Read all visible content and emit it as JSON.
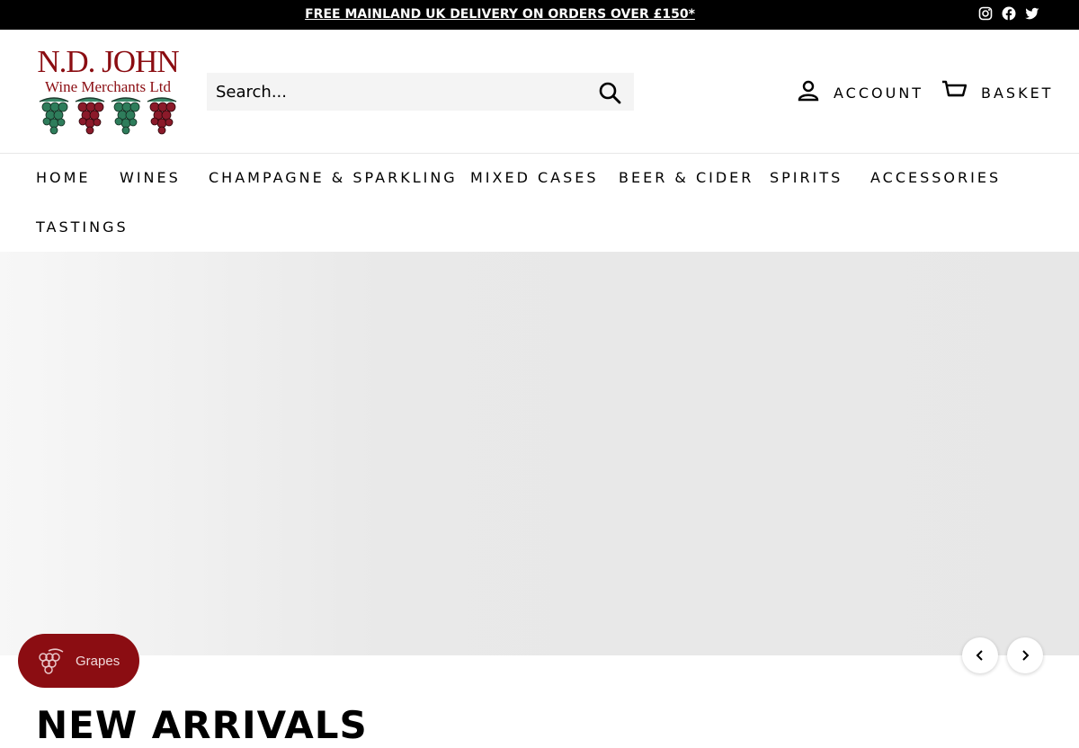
{
  "announcement": {
    "text": "FREE MAINLAND UK DELIVERY ON ORDERS OVER £150*"
  },
  "social": {
    "icons": [
      "instagram-icon",
      "facebook-icon",
      "twitter-icon"
    ]
  },
  "logo": {
    "line1": "N.D. JOHN",
    "line2": "Wine Merchants Ltd"
  },
  "search": {
    "placeholder": "Search..."
  },
  "header": {
    "account_label": "ACCOUNT",
    "basket_label": "BASKET"
  },
  "nav": {
    "items": [
      {
        "label": "HOME"
      },
      {
        "label": "WINES"
      },
      {
        "label": "CHAMPAGNE & SPARKLING"
      },
      {
        "label": "MIXED CASES"
      },
      {
        "label": "BEER & CIDER"
      },
      {
        "label": "SPIRITS"
      },
      {
        "label": "ACCESSORIES"
      },
      {
        "label": "TASTINGS"
      }
    ]
  },
  "rewards": {
    "label": "Grapes"
  },
  "section": {
    "title": "NEW ARRIVALS"
  },
  "colors": {
    "brand": "#8b0d12",
    "grape_green": "#2e7d5b",
    "topbar": "#000000"
  }
}
